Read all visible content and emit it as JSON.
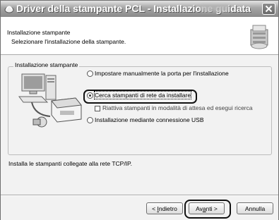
{
  "window": {
    "title": "Driver della stampante PCL - Installazione guidata",
    "icon": "printer-app-icon",
    "close_icon": "close-icon"
  },
  "header": {
    "title": "Installazione stampante",
    "subtitle": "Selezionare l'installazione della stampante.",
    "art": "printer-cd-icon"
  },
  "group": {
    "label": "Installazione stampante"
  },
  "options": {
    "manual_port": {
      "label": "Impostare manualmente la porta per l'installazione",
      "selected": false
    },
    "network_search": {
      "label": "Cerca stampanti di rete da installare",
      "selected": true
    },
    "sleep_mode": {
      "label": "Riattiva stampanti in modalità di attesa ed esegui ricerca",
      "checked": false
    },
    "usb": {
      "label": "Installazione mediante connessione USB",
      "selected": false
    }
  },
  "description": "Installa le stampanti collegate alla rete TCP/IP.",
  "buttons": {
    "back": {
      "pre": "< ",
      "u": "I",
      "post": "ndietro"
    },
    "next": {
      "pre": "Av",
      "u": "a",
      "post": "nti >"
    },
    "cancel": {
      "label": "Annulla"
    }
  },
  "colors": {
    "titlebar": "#9c9c9c",
    "dialog_bg": "#f2f2f2",
    "highlight": "#111111"
  }
}
